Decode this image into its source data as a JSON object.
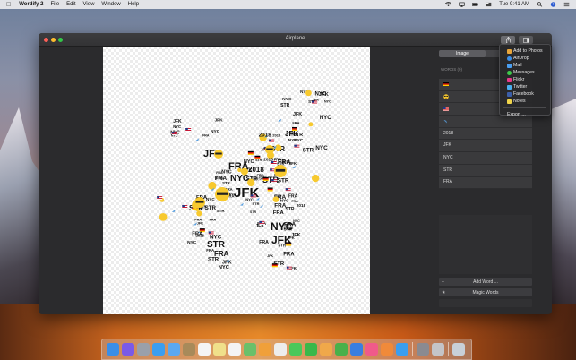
{
  "menubar": {
    "apple_icon": "apple-icon",
    "app_name": "Wordify 2",
    "menus": [
      "File",
      "Edit",
      "View",
      "Window",
      "Help"
    ],
    "clock": "Tue 9:41 AM"
  },
  "window": {
    "title": "Airplane",
    "share_icon": "share-icon",
    "sidebar_icon": "sidebar-toggle-icon"
  },
  "sidebar": {
    "tabs": [
      "Image",
      "Style"
    ],
    "active_tab": "Image",
    "section_label": "WORDS (9)",
    "words": [
      {
        "label": "",
        "icon": "german-flag-icon"
      },
      {
        "label": "",
        "icon": "sunglasses-emoji-icon"
      },
      {
        "label": "",
        "icon": "us-flag-icon"
      },
      {
        "label": "",
        "icon": "airplane-icon"
      },
      {
        "label": "2018"
      },
      {
        "label": "JFK"
      },
      {
        "label": "NYC"
      },
      {
        "label": "STR"
      },
      {
        "label": "FRA"
      }
    ],
    "add_word": "Add Word ...",
    "add_word_prefix": "+",
    "magic_words": "Magic Words",
    "magic_prefix": "★"
  },
  "share_menu": {
    "items": [
      {
        "label": "Add to Photos",
        "icon": "photos-icon",
        "color": "#e8a53a"
      },
      {
        "label": "AirDrop",
        "icon": "airdrop-icon",
        "color": "#3a8ee8"
      },
      {
        "label": "Mail",
        "icon": "mail-icon",
        "color": "#4a9ef0"
      },
      {
        "label": "Messages",
        "icon": "messages-icon",
        "color": "#3ec94a"
      },
      {
        "label": "Flickr",
        "icon": "flickr-icon",
        "color": "#e83a8a"
      },
      {
        "label": "Twitter",
        "icon": "twitter-icon",
        "color": "#4ab0f0"
      },
      {
        "label": "Facebook",
        "icon": "facebook-icon",
        "color": "#3b5ea8"
      },
      {
        "label": "Notes",
        "icon": "notes-icon",
        "color": "#f0d44a"
      }
    ],
    "export": "Export ..."
  },
  "canvas": {
    "words_shown": [
      "NYC",
      "JFK",
      "STR",
      "FRA",
      "2018"
    ]
  },
  "dock": {
    "apps": [
      {
        "name": "finder-icon",
        "color": "#3a8ee8"
      },
      {
        "name": "siri-icon",
        "color": "#7a5ae8"
      },
      {
        "name": "launchpad-icon",
        "color": "#9aa0aa"
      },
      {
        "name": "safari-icon",
        "color": "#3a9ef0"
      },
      {
        "name": "mail-app-icon",
        "color": "#5aa8f0"
      },
      {
        "name": "contacts-icon",
        "color": "#a88a5a"
      },
      {
        "name": "calendar-icon",
        "color": "#f4f4f4"
      },
      {
        "name": "notes-app-icon",
        "color": "#f0e08a"
      },
      {
        "name": "reminders-icon",
        "color": "#f4f4f4"
      },
      {
        "name": "maps-icon",
        "color": "#6ac06a"
      },
      {
        "name": "photos-app-icon",
        "color": "#f0a03a"
      },
      {
        "name": "wordify-icon",
        "color": "#ededed"
      },
      {
        "name": "messages-app-icon",
        "color": "#4ac85a"
      },
      {
        "name": "facetime-icon",
        "color": "#3ab84a"
      },
      {
        "name": "pages-icon",
        "color": "#f0a84a"
      },
      {
        "name": "numbers-icon",
        "color": "#4ab04a"
      },
      {
        "name": "keynote-icon",
        "color": "#3a7ee0"
      },
      {
        "name": "music-icon",
        "color": "#f05a8a"
      },
      {
        "name": "books-icon",
        "color": "#f08a3a"
      },
      {
        "name": "app-store-icon",
        "color": "#3a9ef0"
      },
      {
        "name": "system-preferences-icon",
        "color": "#8a8a90"
      },
      {
        "name": "profile-icon",
        "color": "#c4c4c8"
      },
      {
        "name": "trash-icon",
        "color": "#c8d0d8"
      }
    ]
  }
}
